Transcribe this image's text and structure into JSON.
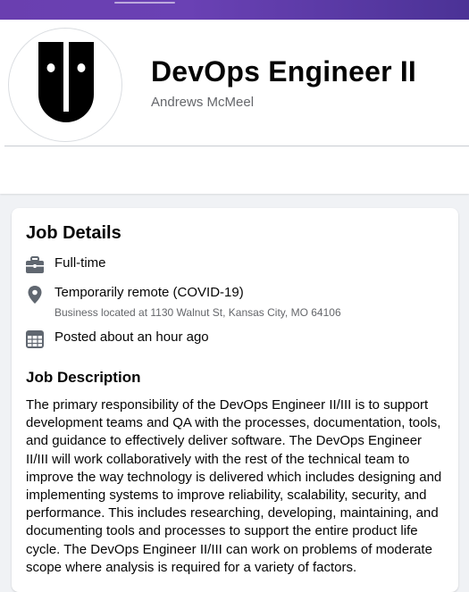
{
  "header": {
    "job_title": "DevOps Engineer II",
    "company": "Andrews McMeel",
    "logo_icon": "company-logo-icon"
  },
  "details": {
    "title": "Job Details",
    "employment_type": "Full-time",
    "location": "Temporarily remote (COVID-19)",
    "address": "Business located at 1130 Walnut St, Kansas City, MO 64106",
    "posted": "Posted about an hour ago",
    "icons": [
      "briefcase-icon",
      "location-pin-icon",
      "calendar-icon"
    ]
  },
  "description": {
    "title": "Job Description",
    "body": "The primary responsibility of the DevOps Engineer II/III is to support development teams and QA with the processes, documentation, tools, and guidance to effectively deliver software. The DevOps Engineer II/III will work collaboratively with the rest of the technical team to improve the way technology is delivered which includes designing and implementing systems to improve reliability, scalability, security, and performance. This includes researching, developing, maintaining, and documenting tools and processes to support the entire product life cycle. The DevOps Engineer II/III can work on problems of moderate scope where analysis is required for a variety of factors."
  },
  "colors": {
    "banner": "#6a41b4",
    "primary_text": "#050505",
    "secondary_text": "#65676b",
    "icon": "#606770"
  }
}
